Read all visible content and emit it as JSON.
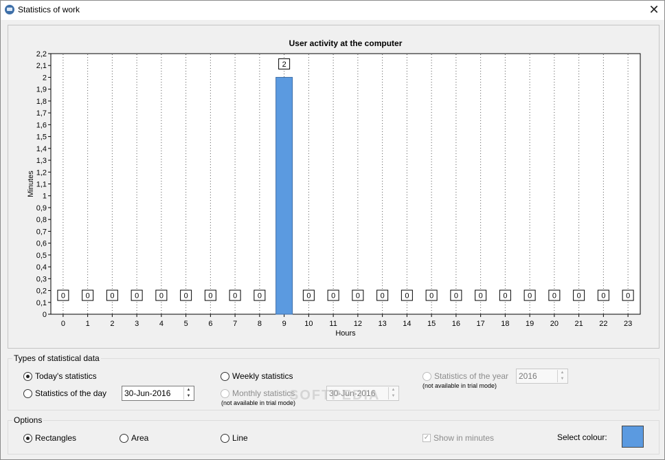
{
  "window": {
    "title": "Statistics of work",
    "close_glyph": "✕"
  },
  "chart_data": {
    "type": "bar",
    "title": "User activity at the computer",
    "xlabel": "Hours",
    "ylabel": "Minutes",
    "categories": [
      "0",
      "1",
      "2",
      "3",
      "4",
      "5",
      "6",
      "7",
      "8",
      "9",
      "10",
      "11",
      "12",
      "13",
      "14",
      "15",
      "16",
      "17",
      "18",
      "19",
      "20",
      "21",
      "22",
      "23"
    ],
    "values": [
      0,
      0,
      0,
      0,
      0,
      0,
      0,
      0,
      0,
      2,
      0,
      0,
      0,
      0,
      0,
      0,
      0,
      0,
      0,
      0,
      0,
      0,
      0,
      0
    ],
    "ylim": [
      0,
      2.2
    ],
    "yticks": [
      "0",
      "0,1",
      "0,2",
      "0,3",
      "0,4",
      "0,5",
      "0,6",
      "0,7",
      "0,8",
      "0,9",
      "1",
      "1,1",
      "1,2",
      "1,3",
      "1,4",
      "1,5",
      "1,6",
      "1,7",
      "1,8",
      "1,9",
      "2",
      "2,1",
      "2,2"
    ],
    "bar_color": "#5b9ae0",
    "grid": "vertical dotted"
  },
  "types": {
    "legend": "Types of statistical data",
    "today": "Today's statistics",
    "day": "Statistics of the day",
    "day_date": "30-Jun-2016",
    "weekly": "Weekly statistics",
    "monthly": "Monthly statistics",
    "monthly_note": "(not available in trial mode)",
    "monthly_date": "30-Jun-2016",
    "year": "Statistics of the year",
    "year_value": "2016",
    "year_note": "(not available in trial mode)"
  },
  "options": {
    "legend": "Options",
    "rectangles": "Rectangles",
    "area": "Area",
    "line": "Line",
    "show_minutes": "Show in minutes",
    "select_colour": "Select colour:",
    "colour": "#5b9ae0"
  },
  "watermark": "SOFTPEDIA"
}
